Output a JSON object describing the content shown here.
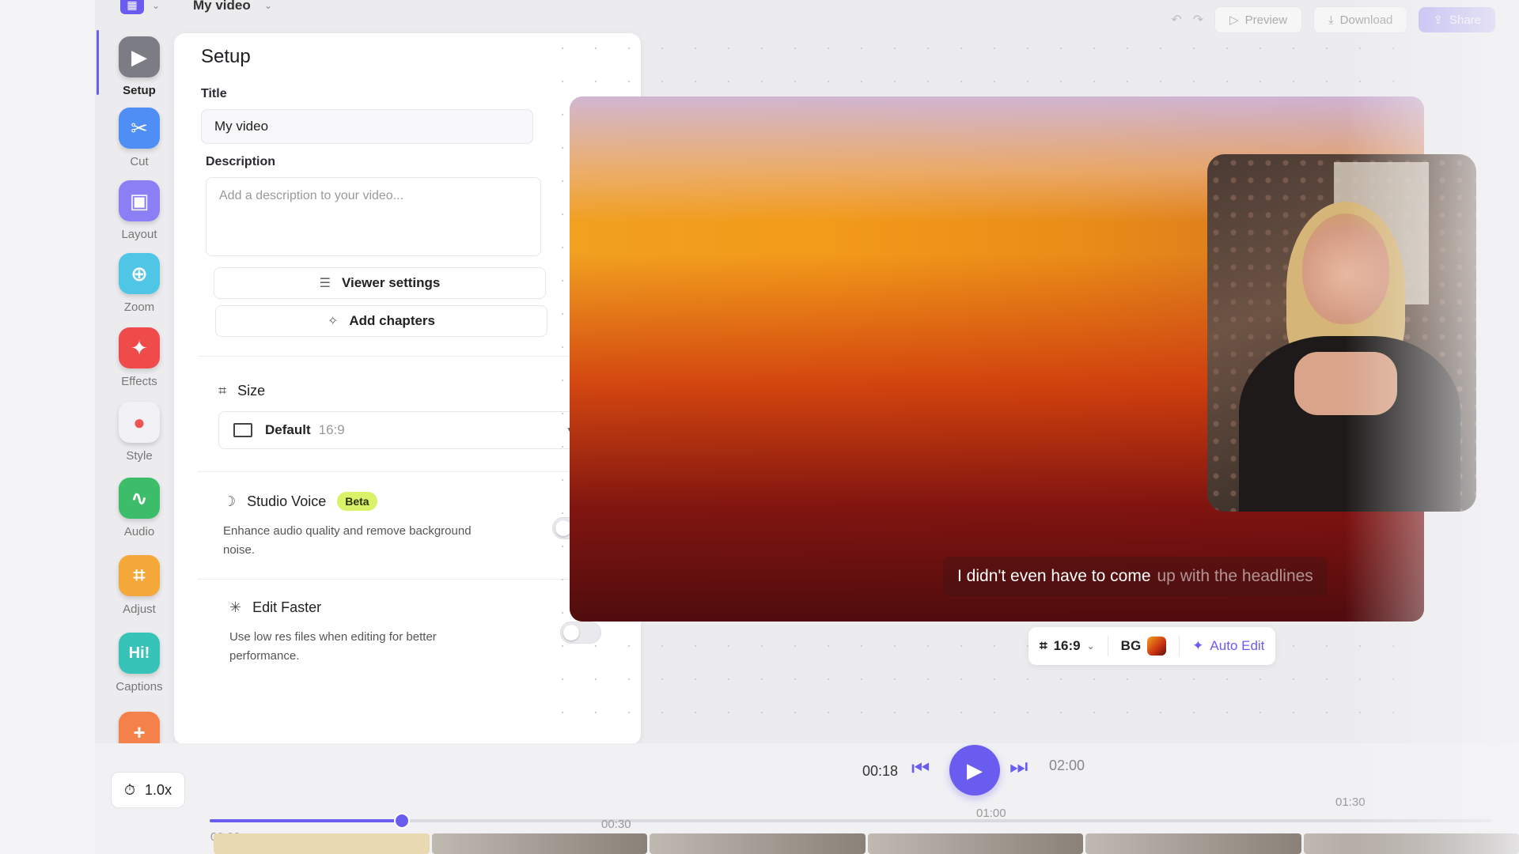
{
  "topbar": {
    "doc_title": "My video",
    "preview_label": "Preview",
    "download_label": "Download",
    "share_label": "Share"
  },
  "rail": {
    "items": [
      {
        "label": "Setup",
        "icon": "clapper-icon",
        "color": "#7c7c84"
      },
      {
        "label": "Cut",
        "icon": "scissors-icon",
        "color": "#4f8ff5"
      },
      {
        "label": "Layout",
        "icon": "layout-icon",
        "color": "#8c7ef5"
      },
      {
        "label": "Zoom",
        "icon": "magnifier-icon",
        "color": "#4fc6e6"
      },
      {
        "label": "Effects",
        "icon": "magic-wand-icon",
        "color": "#ef4b4b"
      },
      {
        "label": "Style",
        "icon": "shapes-icon",
        "color": "#f2f2f6"
      },
      {
        "label": "Audio",
        "icon": "waveform-icon",
        "color": "#3dbd6a"
      },
      {
        "label": "Adjust",
        "icon": "crop-icon",
        "color": "#f5a83a"
      },
      {
        "label": "Captions",
        "icon": "speech-bubble-icon",
        "color": "#37c3b8"
      },
      {
        "label": "",
        "icon": "add-layers-icon",
        "color": "#f5824a"
      }
    ]
  },
  "setup": {
    "title": "Setup",
    "title_label": "Title",
    "title_value": "My video",
    "description_label": "Description",
    "description_placeholder": "Add a description to your video...",
    "viewer_settings": "Viewer settings",
    "add_chapters": "Add chapters",
    "size_label": "Size",
    "size_value": "Default",
    "size_ratio": "16:9",
    "studio_voice": "Studio Voice",
    "studio_badge": "Beta",
    "studio_desc": "Enhance audio quality and remove background noise.",
    "edit_faster": "Edit Faster",
    "edit_desc": "Use low res files when editing for better performance."
  },
  "preview": {
    "caption_spoken": "I didn't even have to come",
    "caption_upcoming": "up with the headlines",
    "toolbar": {
      "ratio": "16:9",
      "bg": "BG",
      "auto_edit": "Auto Edit"
    }
  },
  "transport": {
    "speed": "1.0x",
    "current": "00:18",
    "total": "02:00",
    "progress": 0.15,
    "ticks": [
      "00:00",
      "00:30",
      "01:00",
      "01:30"
    ]
  },
  "colors": {
    "accent": "#6b5cf0",
    "badge": "#d8f26a"
  }
}
